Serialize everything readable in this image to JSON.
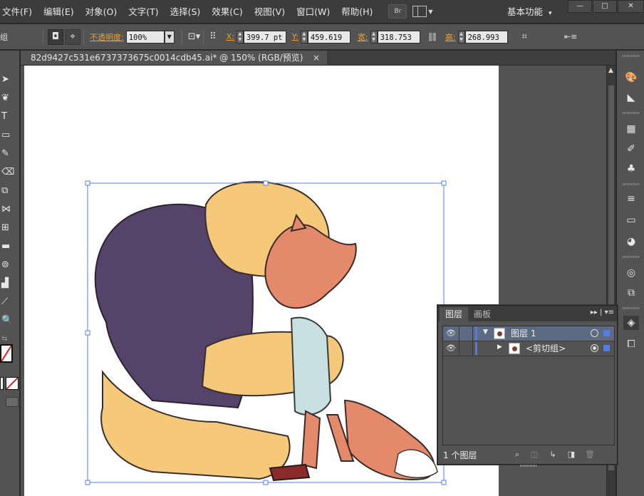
{
  "menubar": {
    "items": [
      "文件(F)",
      "编辑(E)",
      "对象(O)",
      "文字(T)",
      "选择(S)",
      "效果(C)",
      "视图(V)",
      "窗口(W)",
      "帮助(H)"
    ],
    "bridge_label": "Br",
    "workspace_label": "基本功能",
    "workspace_caret": "▾"
  },
  "controlbar": {
    "group_label": "组",
    "opacity_label": "不透明度:",
    "opacity_value": "100%",
    "x_label": "X:",
    "x_value": "399.7 pt",
    "y_label": "Y:",
    "y_value": "459.619",
    "w_label": "宽:",
    "w_value": "318.753",
    "h_label": "高:",
    "h_value": "268.993"
  },
  "document": {
    "tab_title": "82d9427c531e6737373675c0014cdb45.ai* @ 150% (RGB/预览)",
    "close_glyph": "×"
  },
  "layers_panel": {
    "tabs": [
      "图层",
      "画板"
    ],
    "rows": [
      {
        "name": "图层 1",
        "selected": true,
        "expanded": true
      },
      {
        "name": "<剪切组>",
        "selected": false,
        "expanded": false
      }
    ],
    "footer_count": "1 个图层"
  },
  "toolbar": {
    "tools": [
      "selection-tool",
      "direct-selection-tool",
      "type-tool",
      "rectangle-tool",
      "pen-tool",
      "eraser-tool",
      "rotate-tool",
      "warp-tool",
      "symbol-tool",
      "mesh-tool",
      "gradient-tool",
      "blend-tool",
      "column-graph-tool",
      "eyedropper-tool",
      "zoom-tool"
    ]
  },
  "colors": {
    "selection_blue": "#4f7df0",
    "accent_orange": "#f0a030",
    "artboard": "#ffffff",
    "ui_dark": "#535353"
  }
}
